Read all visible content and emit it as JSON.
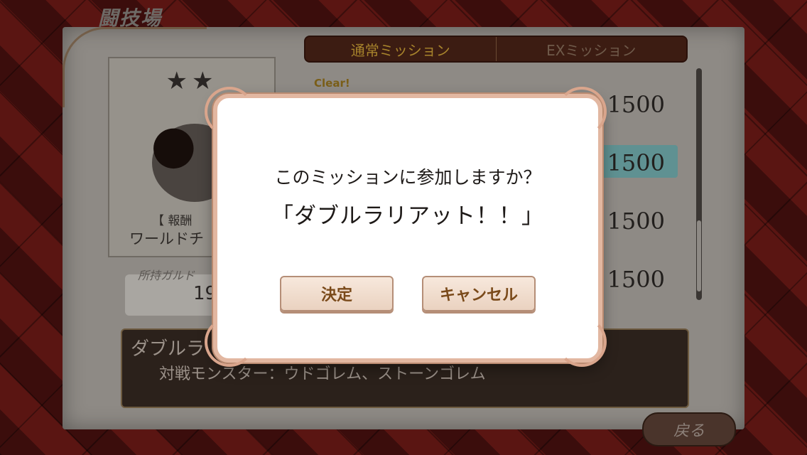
{
  "screen": {
    "title": "闘技場"
  },
  "tabs": [
    {
      "label": "通常ミッション",
      "active": true
    },
    {
      "label": "EXミッション",
      "active": false
    }
  ],
  "reward_card": {
    "stars": "★★",
    "reward_label": "【 報酬",
    "reward_name": "ワールドチ"
  },
  "guild": {
    "label": "所持ガルド",
    "value": "19"
  },
  "missions": [
    {
      "tag": "Clear!",
      "reward": "1500"
    },
    {
      "reward": "1500",
      "selected": true
    },
    {
      "reward": "1500"
    },
    {
      "reward": "1500"
    }
  ],
  "description": {
    "title": "ダブルラ",
    "monsters": "対戦モンスター：ウドゴレム、ストーンゴレム"
  },
  "back_button": {
    "label": "戻る"
  },
  "dialog": {
    "question": "このミッションに参加しますか？",
    "mission_name": "「ダブルラリアット！！」",
    "ok_label": "決定",
    "cancel_label": "キャンセル"
  },
  "colors": {
    "selected_highlight": "#4096a0",
    "dialog_border": "#e2b7a1",
    "button_text": "#7a4a1a"
  }
}
